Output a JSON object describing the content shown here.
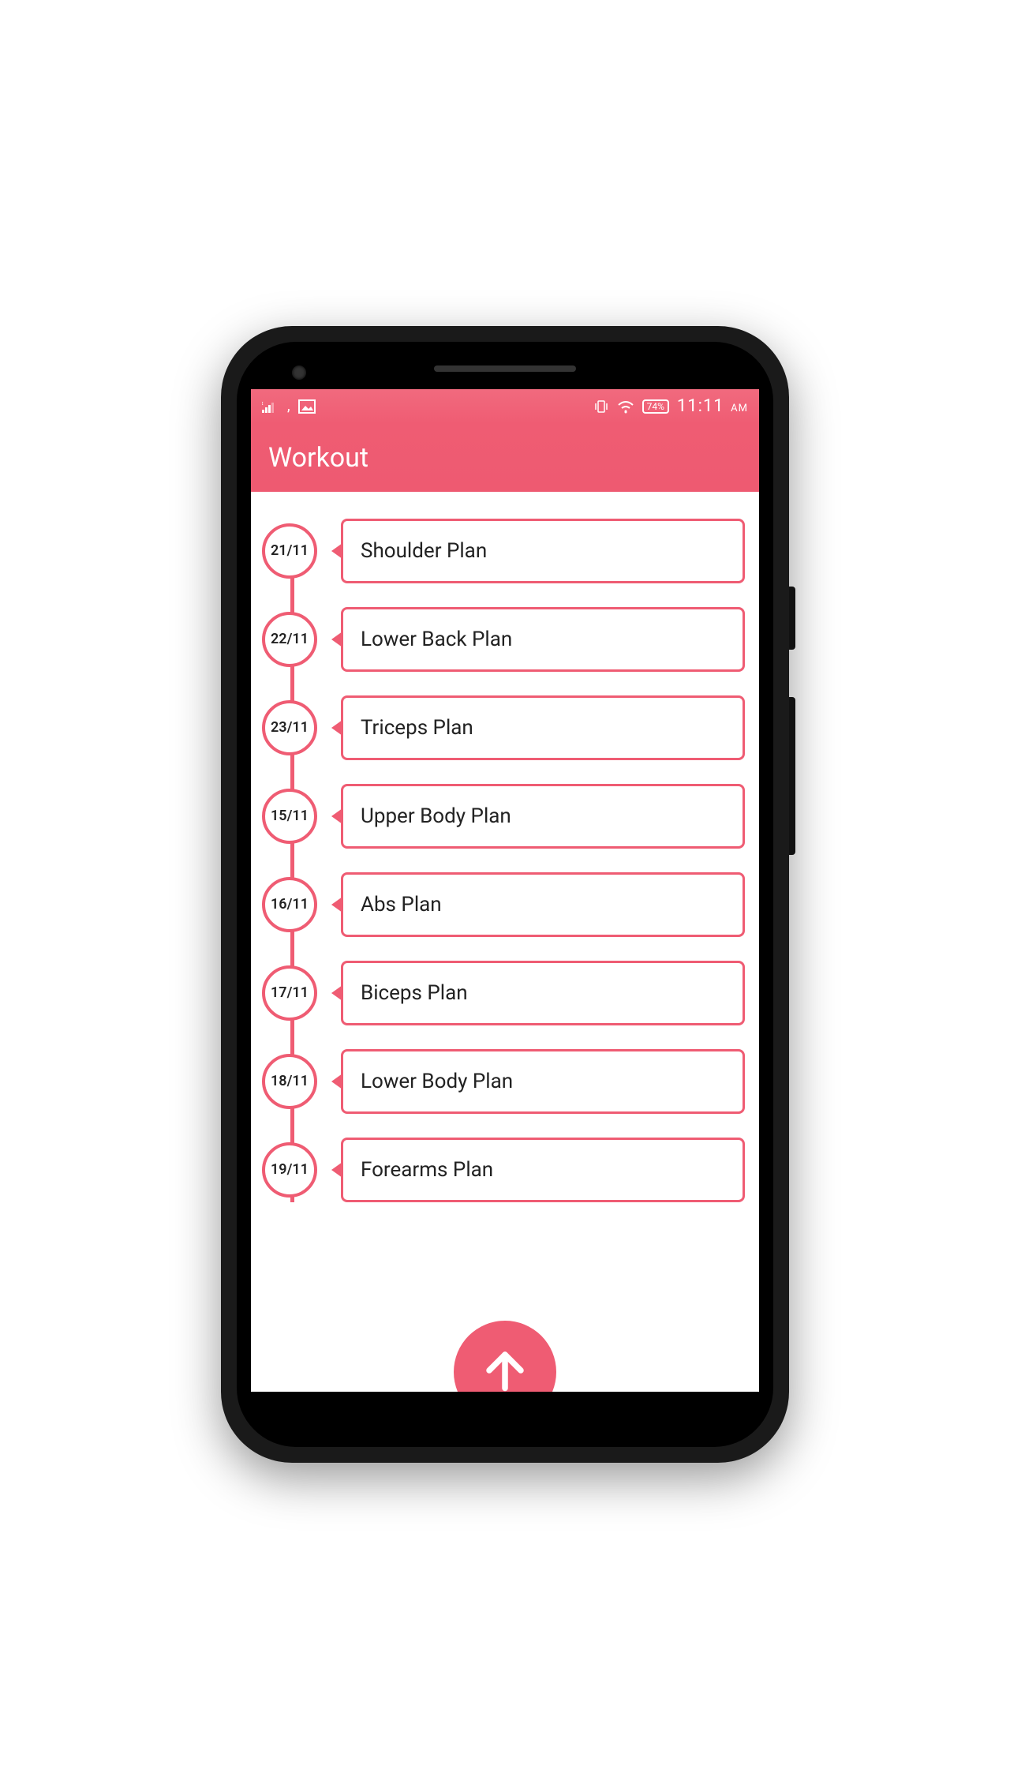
{
  "status": {
    "time": "11:11",
    "ampm": "AM",
    "battery": "74%"
  },
  "header": {
    "title": "Workout"
  },
  "plans": [
    {
      "date": "21/11",
      "name": "Shoulder Plan"
    },
    {
      "date": "22/11",
      "name": "Lower Back Plan"
    },
    {
      "date": "23/11",
      "name": "Triceps Plan"
    },
    {
      "date": "15/11",
      "name": "Upper Body Plan"
    },
    {
      "date": "16/11",
      "name": "Abs Plan"
    },
    {
      "date": "17/11",
      "name": "Biceps Plan"
    },
    {
      "date": "18/11",
      "name": "Lower Body Plan"
    },
    {
      "date": "19/11",
      "name": "Forearms Plan"
    }
  ],
  "colors": {
    "accent": "#ef5c73"
  }
}
